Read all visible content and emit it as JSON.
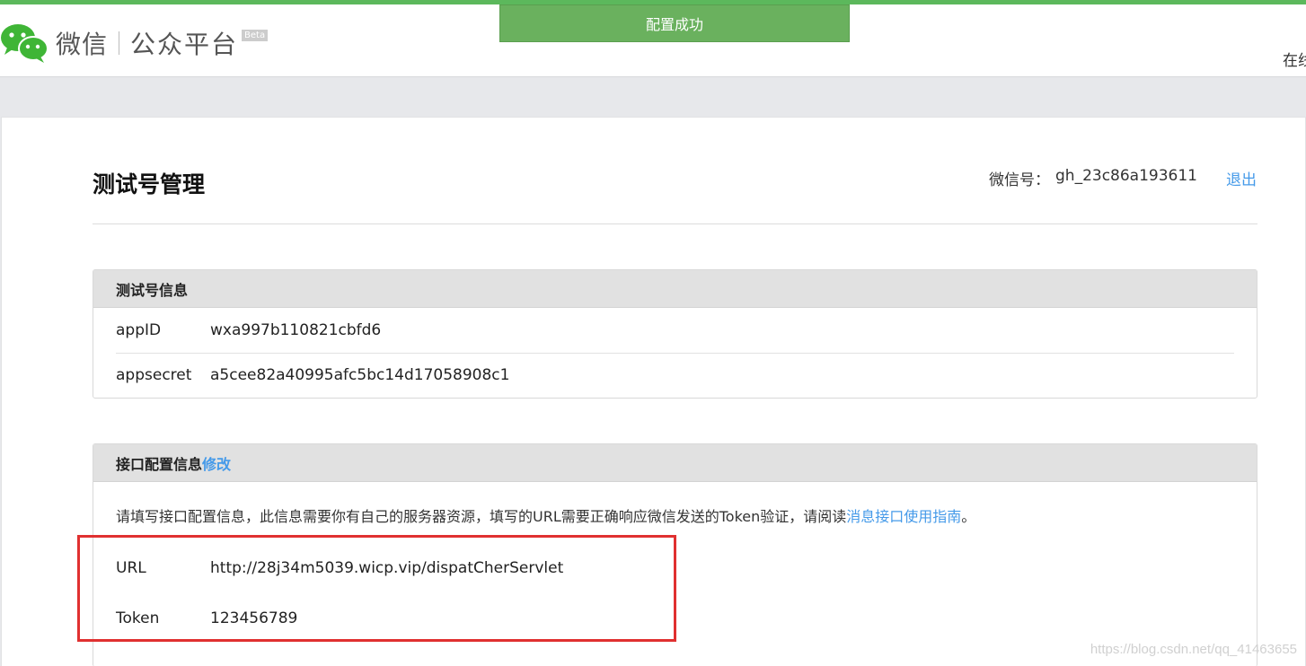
{
  "header": {
    "brand": "微信",
    "platform": "公众平台",
    "beta": "Beta",
    "toast": "配置成功",
    "top_right_text": "在线"
  },
  "main": {
    "title": "测试号管理",
    "account_label": "微信号：",
    "account_id": "gh_23c86a193611",
    "logout": "退出"
  },
  "test_info": {
    "heading": "测试号信息",
    "rows": [
      {
        "key": "appID",
        "value": "wxa997b110821cbfd6"
      },
      {
        "key": "appsecret",
        "value": "a5cee82a40995afc5bc14d17058908c1"
      }
    ]
  },
  "interface": {
    "heading": "接口配置信息",
    "edit": "修改",
    "description": "请填写接口配置信息，此信息需要你有自己的服务器资源，填写的URL需要正确响应微信发送的Token验证，请阅读",
    "guide_link": "消息接口使用指南",
    "description_end": "。",
    "url_label": "URL",
    "url_value": "http://28j34m5039.wicp.vip/dispatCherServlet",
    "token_label": "Token",
    "token_value": "123456789"
  },
  "watermark": "https://blog.csdn.net/qq_41463655",
  "colors": {
    "accent_green": "#6ab15e",
    "link_blue": "#459ae9",
    "highlight_red": "#e03030"
  }
}
